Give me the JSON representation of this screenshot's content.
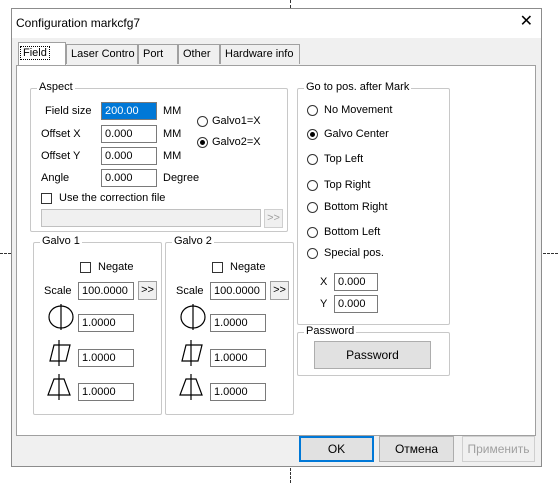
{
  "window": {
    "title": "Configuration markcfg7"
  },
  "tabs": [
    "Field",
    "Laser Contro",
    "Port",
    "Other",
    "Hardware info"
  ],
  "aspect": {
    "title": "Aspect",
    "field_size": {
      "label": "Field size",
      "value": "200.00",
      "unit": "MM"
    },
    "offset_x": {
      "label": "Offset X",
      "value": "0.000",
      "unit": "MM"
    },
    "offset_y": {
      "label": "Offset Y",
      "value": "0.000",
      "unit": "MM"
    },
    "angle": {
      "label": "Angle",
      "value": "0.000",
      "unit": "Degree"
    },
    "galvo_option1": "Galvo1=X",
    "galvo_option2": "Galvo2=X",
    "galvo_selected": 2,
    "use_correction_label": "Use the correction file",
    "browse_label": ">>"
  },
  "galvo1": {
    "title": "Galvo 1",
    "negate_label": "Negate",
    "scale_label": "Scale",
    "scale_value": "100.0000",
    "scale_button": ">>",
    "v1": "1.0000",
    "v2": "1.0000",
    "v3": "1.0000"
  },
  "galvo2": {
    "title": "Galvo 2",
    "negate_label": "Negate",
    "scale_label": "Scale",
    "scale_value": "100.0000",
    "scale_button": ">>",
    "v1": "1.0000",
    "v2": "1.0000",
    "v3": "1.0000"
  },
  "goto": {
    "title": "Go to pos. after Mark",
    "options": [
      "No Movement",
      "Galvo Center",
      "Top Left",
      "Top Right",
      "Bottom Right",
      "Bottom Left",
      "Special pos."
    ],
    "selected_index": 1,
    "x_label": "X",
    "x_value": "0.000",
    "y_label": "Y",
    "y_value": "0.000"
  },
  "password": {
    "title": "Password",
    "button": "Password"
  },
  "buttons": {
    "ok": "OK",
    "cancel": "Отмена",
    "apply": "Применить"
  }
}
